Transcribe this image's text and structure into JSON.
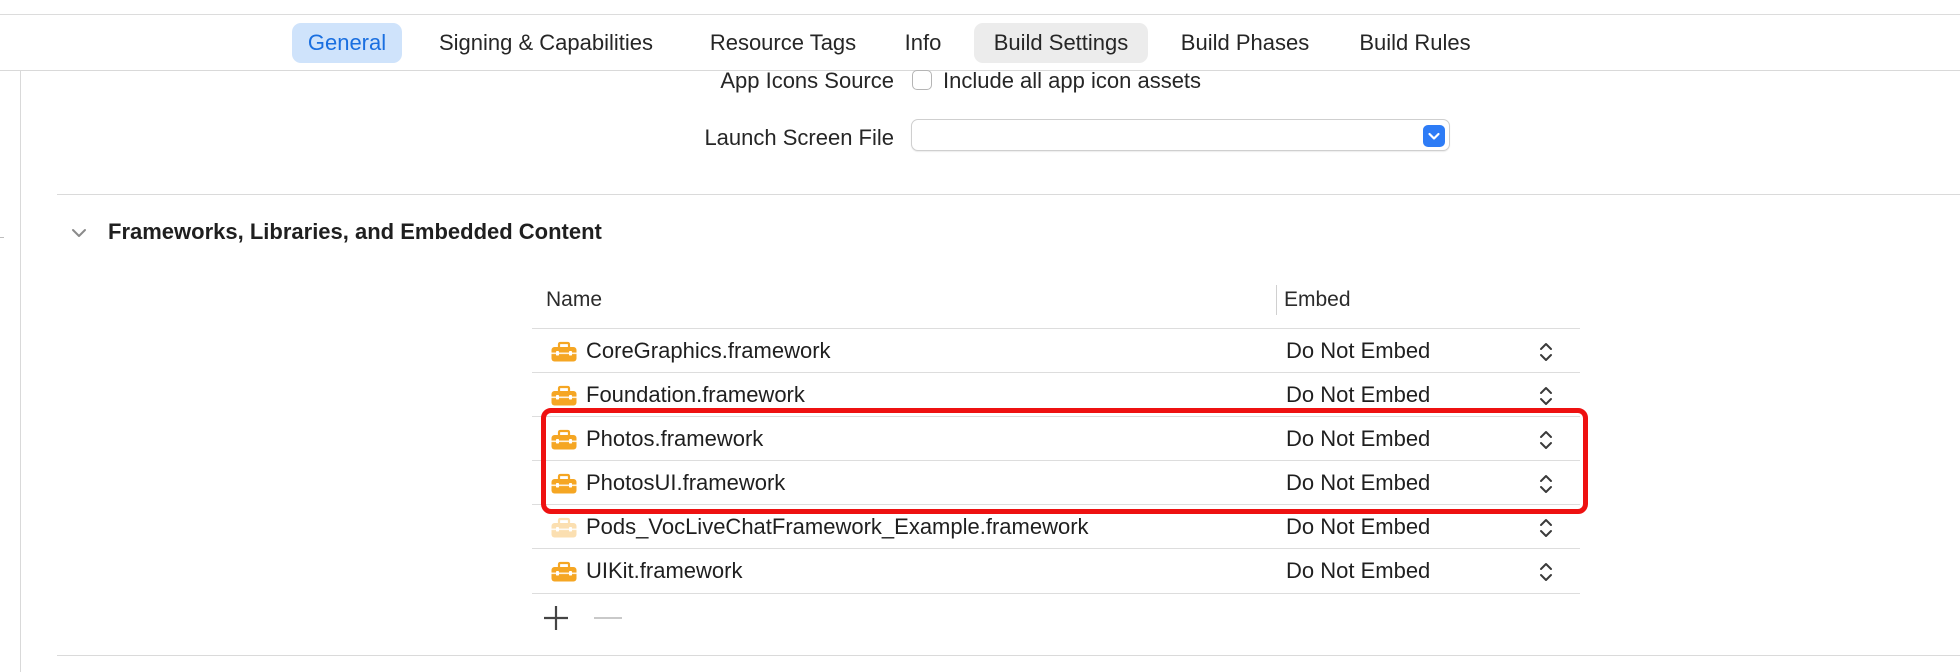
{
  "tabs": [
    {
      "label": "General",
      "state": "selected"
    },
    {
      "label": "Signing & Capabilities",
      "state": "normal"
    },
    {
      "label": "Resource Tags",
      "state": "normal"
    },
    {
      "label": "Info",
      "state": "normal"
    },
    {
      "label": "Build Settings",
      "state": "hover"
    },
    {
      "label": "Build Phases",
      "state": "normal"
    },
    {
      "label": "Build Rules",
      "state": "normal"
    }
  ],
  "app_icons": {
    "label": "App Icons Source",
    "checkbox_label": "Include all app icon assets",
    "checked": false
  },
  "launch_screen": {
    "label": "Launch Screen File",
    "value": ""
  },
  "frameworks_section": {
    "title": "Frameworks, Libraries, and Embedded Content",
    "columns": {
      "name": "Name",
      "embed": "Embed"
    },
    "rows": [
      {
        "name": "CoreGraphics.framework",
        "embed": "Do Not Embed",
        "dimmed": false
      },
      {
        "name": "Foundation.framework",
        "embed": "Do Not Embed",
        "dimmed": false
      },
      {
        "name": "Photos.framework",
        "embed": "Do Not Embed",
        "dimmed": false
      },
      {
        "name": "PhotosUI.framework",
        "embed": "Do Not Embed",
        "dimmed": false
      },
      {
        "name": "Pods_VocLiveChatFramework_Example.framework",
        "embed": "Do Not Embed",
        "dimmed": true
      },
      {
        "name": "UIKit.framework",
        "embed": "Do Not Embed",
        "dimmed": false
      }
    ],
    "highlighted_rows": [
      "Photos.framework",
      "PhotosUI.framework"
    ]
  },
  "colors": {
    "accent": "#1a6fe0",
    "selected_tab_bg": "#cfe3fb",
    "framework_icon": "#f5a623",
    "highlight_border": "#ee1111"
  },
  "icons": {
    "framework": "toolbox-icon",
    "disclosure": "chevron-down-icon",
    "stepper": "up-down-chevron-icon",
    "add": "plus-icon",
    "remove": "minus-icon"
  }
}
